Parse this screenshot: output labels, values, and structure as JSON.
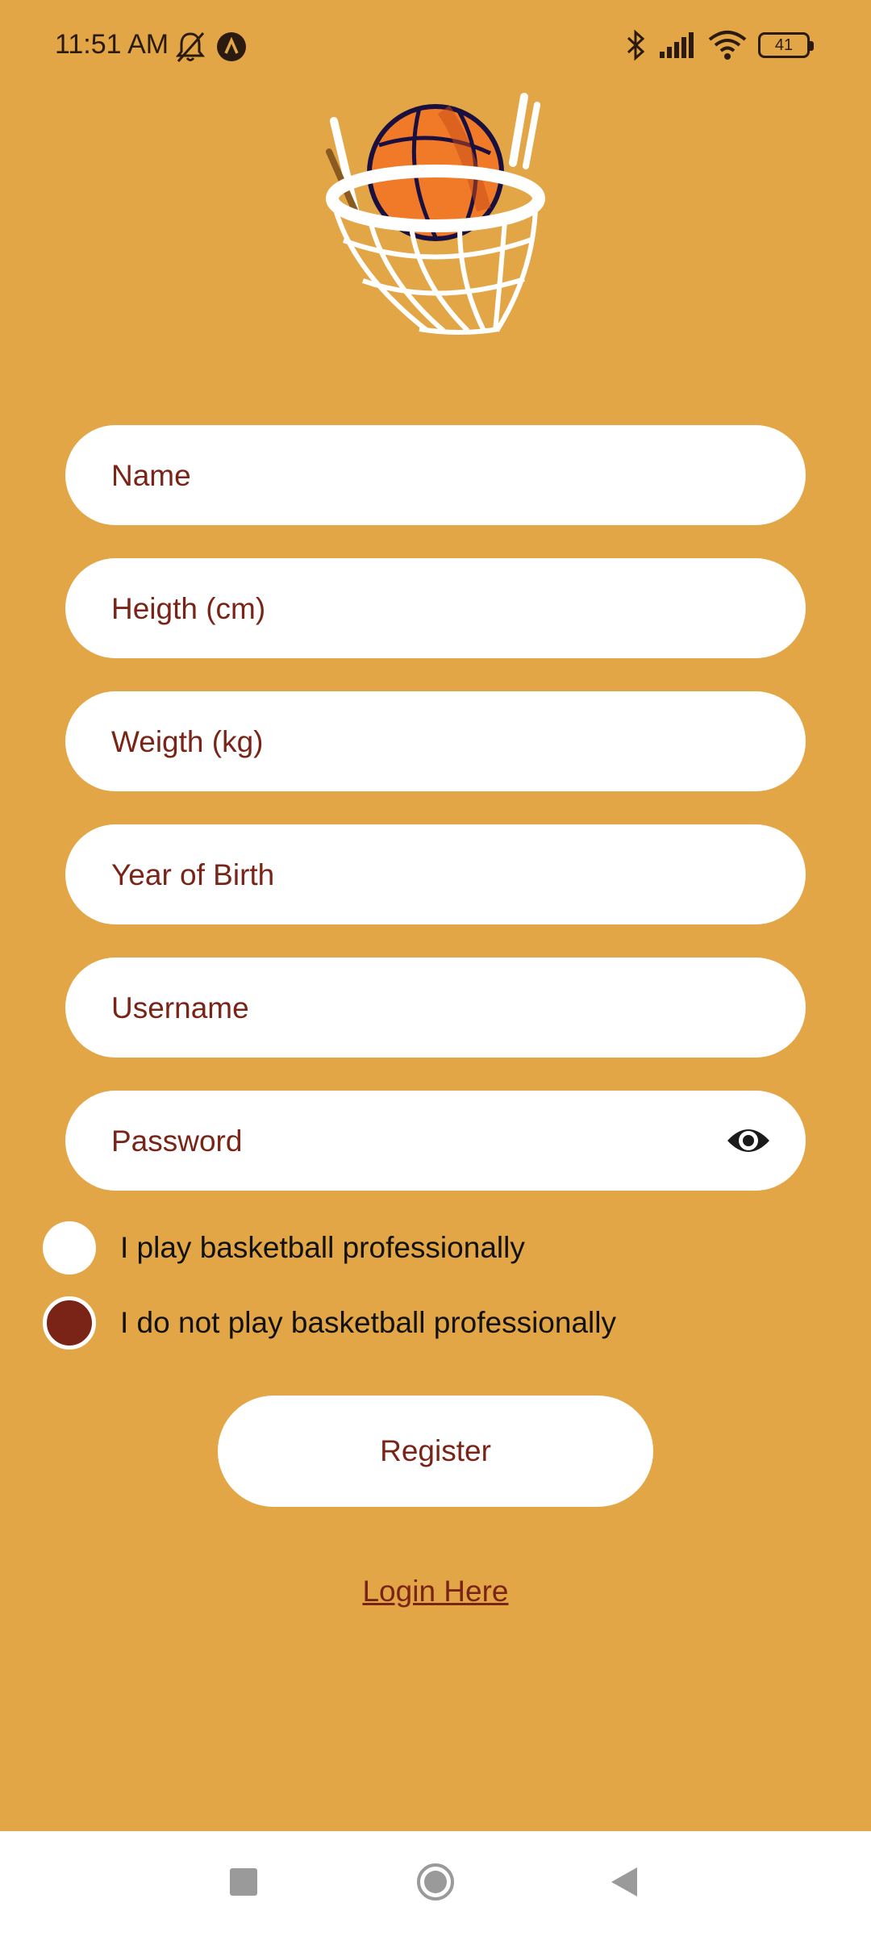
{
  "status_bar": {
    "time": "11:51 AM",
    "battery_level": "41",
    "icons": [
      "bell-off-icon",
      "app-a-icon",
      "bluetooth-icon",
      "signal-icon",
      "wifi-icon",
      "battery-icon"
    ]
  },
  "logo": {
    "icon": "basketball-hoop-icon"
  },
  "form": {
    "name_placeholder": "Name",
    "height_placeholder": "Heigth (cm)",
    "weight_placeholder": "Weigth (kg)",
    "birth_year_placeholder": "Year of Birth",
    "username_placeholder": "Username",
    "password_placeholder": "Password"
  },
  "options": {
    "professional_label": "I play basketball professionally",
    "not_professional_label": "I do not play basketball professionally",
    "selected": "not_professional"
  },
  "actions": {
    "register_label": "Register",
    "login_label": "Login Here"
  },
  "colors": {
    "background": "#e3a646",
    "accent": "#7a2418",
    "field": "#ffffff"
  }
}
